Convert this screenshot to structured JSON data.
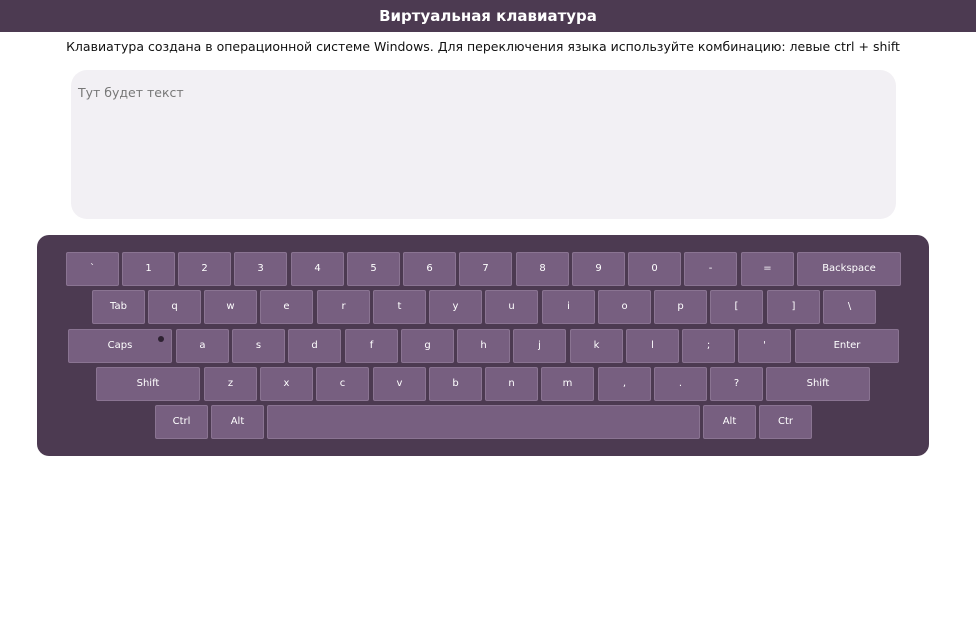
{
  "header": {
    "title": "Виртуальная клавиатура"
  },
  "hint": {
    "text": "Клавиатура создана в операционной системе Windows. Для переключения языка используйте комбинацию: левые ctrl + shift"
  },
  "textarea": {
    "placeholder": "Тут будет текст"
  },
  "keyboard": {
    "rows": [
      [
        {
          "label": "`",
          "name": "key-backtick"
        },
        {
          "label": "1",
          "name": "key-1"
        },
        {
          "label": "2",
          "name": "key-2"
        },
        {
          "label": "3",
          "name": "key-3"
        },
        {
          "label": "4",
          "name": "key-4"
        },
        {
          "label": "5",
          "name": "key-5"
        },
        {
          "label": "6",
          "name": "key-6"
        },
        {
          "label": "7",
          "name": "key-7"
        },
        {
          "label": "8",
          "name": "key-8"
        },
        {
          "label": "9",
          "name": "key-9"
        },
        {
          "label": "0",
          "name": "key-0"
        },
        {
          "label": "-",
          "name": "key-minus"
        },
        {
          "label": "=",
          "name": "key-equals"
        },
        {
          "label": "Backspace",
          "name": "key-backspace"
        }
      ],
      [
        {
          "label": "Tab",
          "name": "key-tab"
        },
        {
          "label": "q",
          "name": "key-q"
        },
        {
          "label": "w",
          "name": "key-w"
        },
        {
          "label": "e",
          "name": "key-e"
        },
        {
          "label": "r",
          "name": "key-r"
        },
        {
          "label": "t",
          "name": "key-t"
        },
        {
          "label": "y",
          "name": "key-y"
        },
        {
          "label": "u",
          "name": "key-u"
        },
        {
          "label": "i",
          "name": "key-i"
        },
        {
          "label": "o",
          "name": "key-o"
        },
        {
          "label": "p",
          "name": "key-p"
        },
        {
          "label": "[",
          "name": "key-left-bracket"
        },
        {
          "label": "]",
          "name": "key-right-bracket"
        },
        {
          "label": "\\",
          "name": "key-backslash"
        }
      ],
      [
        {
          "label": "Caps",
          "name": "key-caps",
          "indicator": "off"
        },
        {
          "label": "a",
          "name": "key-a"
        },
        {
          "label": "s",
          "name": "key-s"
        },
        {
          "label": "d",
          "name": "key-d"
        },
        {
          "label": "f",
          "name": "key-f"
        },
        {
          "label": "g",
          "name": "key-g"
        },
        {
          "label": "h",
          "name": "key-h"
        },
        {
          "label": "j",
          "name": "key-j"
        },
        {
          "label": "k",
          "name": "key-k"
        },
        {
          "label": "l",
          "name": "key-l"
        },
        {
          "label": ";",
          "name": "key-semicolon"
        },
        {
          "label": "'",
          "name": "key-quote"
        },
        {
          "label": "Enter",
          "name": "key-enter"
        }
      ],
      [
        {
          "label": "Shift",
          "name": "key-shift-left"
        },
        {
          "label": "z",
          "name": "key-z"
        },
        {
          "label": "x",
          "name": "key-x"
        },
        {
          "label": "c",
          "name": "key-c"
        },
        {
          "label": "v",
          "name": "key-v"
        },
        {
          "label": "b",
          "name": "key-b"
        },
        {
          "label": "n",
          "name": "key-n"
        },
        {
          "label": "m",
          "name": "key-m"
        },
        {
          "label": ",",
          "name": "key-comma"
        },
        {
          "label": ".",
          "name": "key-period"
        },
        {
          "label": "?",
          "name": "key-question"
        },
        {
          "label": "Shift",
          "name": "key-shift-right"
        }
      ],
      [
        {
          "label": "Ctrl",
          "name": "key-ctrl-left"
        },
        {
          "label": "Alt",
          "name": "key-alt-left"
        },
        {
          "label": "",
          "name": "key-space"
        },
        {
          "label": "Alt",
          "name": "key-alt-right"
        },
        {
          "label": "Ctr",
          "name": "key-ctrl-right"
        }
      ]
    ]
  },
  "colors": {
    "header_bg": "#4c3a51",
    "key_bg": "#775f80",
    "textarea_bg": "#f2f0f4"
  }
}
